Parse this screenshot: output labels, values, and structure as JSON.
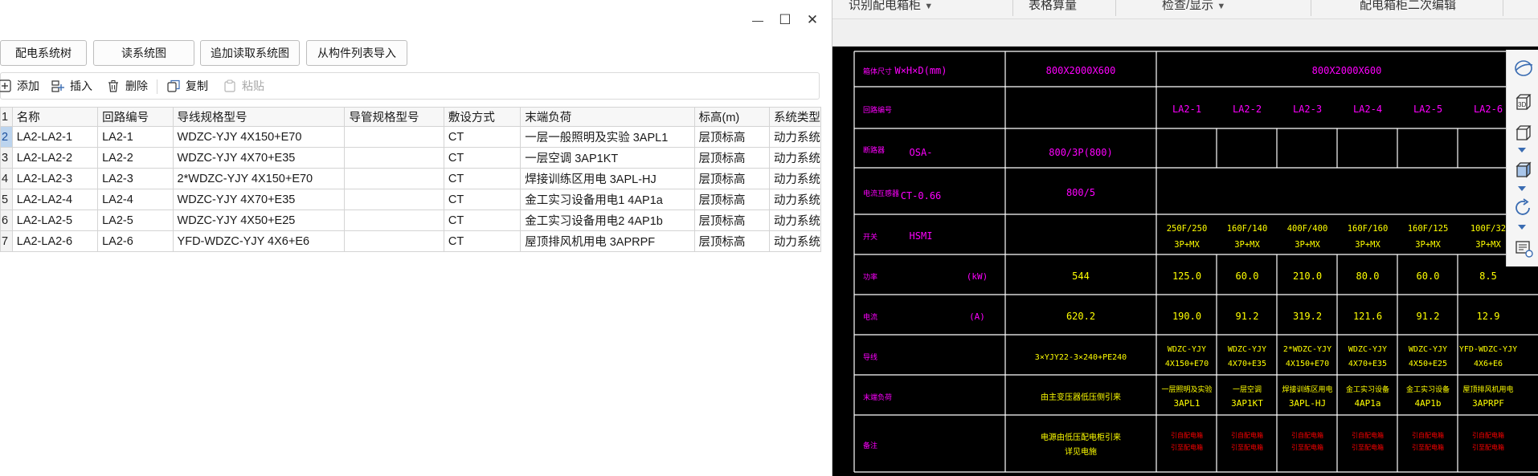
{
  "cad": {
    "toolbar": [
      {
        "label": "识别配电箱柜",
        "has_dropdown": true
      },
      {
        "label": "表格算量",
        "has_dropdown": false
      },
      {
        "label": "检查/显示",
        "has_dropdown": true
      },
      {
        "label": "配电箱柜二次编辑",
        "has_dropdown": false
      }
    ],
    "drawing": {
      "row_labels": [
        "箱体尺寸",
        "回路编号",
        "断路器",
        "电流互感器",
        "开关",
        "功率",
        "电流",
        "导线",
        "末端负荷",
        "备注"
      ],
      "size_header": "W×H×D(mm)",
      "size_main": "800X2000X600",
      "size_span": "800X2000X600",
      "breaker_model": "OSA-",
      "breaker_main": "800/3P(800)",
      "ct_model": "CT-0.66",
      "ct_main": "800/5",
      "switch_model": "HSMI",
      "power_unit": "(kW)",
      "power_main": "544",
      "current_unit": "(A)",
      "current_main": "620.2",
      "cable_main": "3×YJY22-3×240+PE240",
      "load_main": "由主变压器低压侧引来",
      "note_main": [
        "电源由低压配电柜引来",
        "详见电施"
      ],
      "circuits": [
        {
          "id": "LA2-1",
          "switch": [
            "250F/250",
            "3P+MX"
          ],
          "power": "125.0",
          "current": "190.0",
          "cable": [
            "WDZC-YJY",
            "4X150+E70"
          ],
          "load": [
            "一层照明及实验",
            "3APL1"
          ],
          "note": [
            "引自配电箱",
            "引至配电箱"
          ]
        },
        {
          "id": "LA2-2",
          "switch": [
            "160F/140",
            "3P+MX"
          ],
          "power": "60.0",
          "current": "91.2",
          "cable": [
            "WDZC-YJY",
            "4X70+E35"
          ],
          "load": [
            "一层空调",
            "3AP1KT"
          ],
          "note": [
            "引自配电箱",
            "引至配电箱"
          ]
        },
        {
          "id": "LA2-3",
          "switch": [
            "400F/400",
            "3P+MX"
          ],
          "power": "210.0",
          "current": "319.2",
          "cable": [
            "2*WDZC-YJY",
            "4X150+E70"
          ],
          "load": [
            "焊接训练区用电",
            "3APL-HJ"
          ],
          "note": [
            "引自配电箱",
            "引至配电箱"
          ]
        },
        {
          "id": "LA2-4",
          "switch": [
            "160F/160",
            "3P+MX"
          ],
          "power": "80.0",
          "current": "121.6",
          "cable": [
            "WDZC-YJY",
            "4X70+E35"
          ],
          "load": [
            "金工实习设备",
            "4AP1a"
          ],
          "note": [
            "引自配电箱",
            "引至配电箱"
          ]
        },
        {
          "id": "LA2-5",
          "switch": [
            "160F/125",
            "3P+MX"
          ],
          "power": "60.0",
          "current": "91.2",
          "cable": [
            "WDZC-YJY",
            "4X50+E25"
          ],
          "load": [
            "金工实习设备",
            "4AP1b"
          ],
          "note": [
            "引自配电箱",
            "引至配电箱"
          ]
        },
        {
          "id": "LA2-6",
          "switch": [
            "100F/32",
            "3P+MX"
          ],
          "power": "8.5",
          "current": "12.9",
          "cable": [
            "YFD-WDZC-YJY",
            "4X6+E6"
          ],
          "load": [
            "屋顶排风机用电",
            "3APRPF"
          ],
          "note": [
            "引自配电箱",
            "引至配电箱"
          ]
        }
      ]
    }
  },
  "dialog": {
    "window_controls": {
      "minimize": "—",
      "maximize": "☐",
      "close": "✕"
    },
    "toolbar1": [
      "配电系统树",
      "读系统图",
      "追加读取系统图",
      "从构件列表导入"
    ],
    "toolbar2": [
      {
        "label": "添加",
        "icon": "add-icon",
        "disabled": false
      },
      {
        "label": "插入",
        "icon": "insert-icon",
        "disabled": false
      },
      {
        "label": "删除",
        "icon": "trash-icon",
        "disabled": false
      },
      {
        "label": "复制",
        "icon": "copy-icon",
        "disabled": false
      },
      {
        "label": "粘贴",
        "icon": "paste-icon",
        "disabled": true
      }
    ],
    "table": {
      "row_number_header": "1",
      "columns": [
        "名称",
        "回路编号",
        "导线规格型号",
        "导管规格型号",
        "敷设方式",
        "末端负荷",
        "标高(m)",
        "系统类型"
      ],
      "rows": [
        {
          "no": "2",
          "cells": [
            "LA2-LA2-1",
            "LA2-1",
            "WDZC-YJY 4X150+E70",
            "",
            "CT",
            "一层一般照明及实验 3APL1",
            "层顶标高",
            "动力系统"
          ]
        },
        {
          "no": "3",
          "cells": [
            "LA2-LA2-2",
            "LA2-2",
            "WDZC-YJY 4X70+E35",
            "",
            "CT",
            "一层空调 3AP1KT",
            "层顶标高",
            "动力系统"
          ]
        },
        {
          "no": "4",
          "cells": [
            "LA2-LA2-3",
            "LA2-3",
            "2*WDZC-YJY 4X150+E70",
            "",
            "CT",
            "焊接训练区用电 3APL-HJ",
            "层顶标高",
            "动力系统"
          ]
        },
        {
          "no": "5",
          "cells": [
            "LA2-LA2-4",
            "LA2-4",
            "WDZC-YJY 4X70+E35",
            "",
            "CT",
            "金工实习设备用电1 4AP1a",
            "层顶标高",
            "动力系统"
          ]
        },
        {
          "no": "6",
          "cells": [
            "LA2-LA2-5",
            "LA2-5",
            "WDZC-YJY 4X50+E25",
            "",
            "CT",
            "金工实习设备用电2 4AP1b",
            "层顶标高",
            "动力系统"
          ]
        },
        {
          "no": "7",
          "cells": [
            "LA2-LA2-6",
            "LA2-6",
            "YFD-WDZC-YJY 4X6+E6",
            "",
            "CT",
            "屋顶排风机用电 3APRPF",
            "层顶标高",
            "动力系统"
          ]
        }
      ]
    }
  },
  "colors": {
    "cad_bg": "#000000",
    "cad_line": "#ffffff",
    "cad_magenta": "#ff00ff",
    "cad_yellow": "#ffff00",
    "cad_red": "#ff0000",
    "selected_row": "#bcd4ee",
    "accent_icon": "#3a6cb2"
  }
}
